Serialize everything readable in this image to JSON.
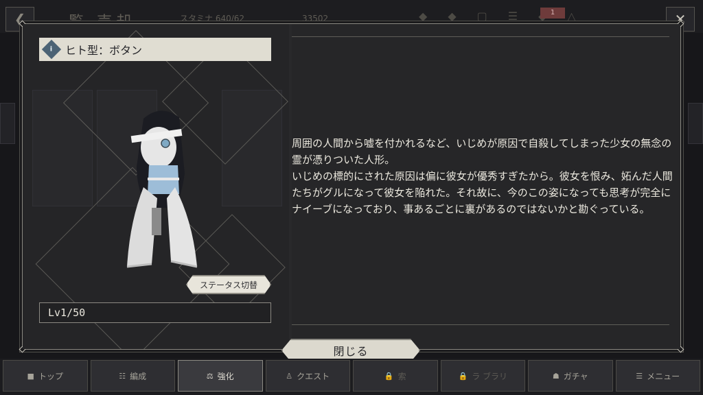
{
  "background": {
    "title": "覧",
    "sell_label": "売却",
    "stamina_label": "スタミナ",
    "stamina_value": "640/62",
    "coins": "33502",
    "badge_count": "1"
  },
  "character": {
    "name": "ヒト型：ボタン",
    "type_icon": "diamond-type-icon",
    "level": "Lv1/50",
    "status_toggle_label": "ステータス切替",
    "description": "周囲の人間から嘘を付かれるなど、いじめが原因で自殺してしまった少女の無念の霊が憑りついた人形。\nいじめの標的にされた原因は偏に彼女が優秀すぎたから。彼女を恨み、妬んだ人間たちがグルになって彼女を陥れた。それ故に、今のこの姿になっても思考が完全にナイーブになっており、事あるごとに裏があるのではないかと勘ぐっている。"
  },
  "dialog": {
    "close_label": "閉じる"
  },
  "nav": [
    {
      "label": "トップ",
      "icon": "home-icon"
    },
    {
      "label": "編成",
      "icon": "formation-icon"
    },
    {
      "label": "強化",
      "icon": "enhance-icon"
    },
    {
      "label": "クエスト",
      "icon": "quest-icon"
    },
    {
      "label": "索",
      "icon": "lock-icon"
    },
    {
      "label": "ラ  ブラリ",
      "icon": "lock-icon"
    },
    {
      "label": "ガチャ",
      "icon": "gacha-icon"
    },
    {
      "label": "メニュー",
      "icon": "menu-icon"
    }
  ],
  "colors": {
    "panel": "#29292b",
    "name_plate": "#e0ddd2",
    "type_icon": "#4c6375",
    "text": "#ece9df"
  }
}
